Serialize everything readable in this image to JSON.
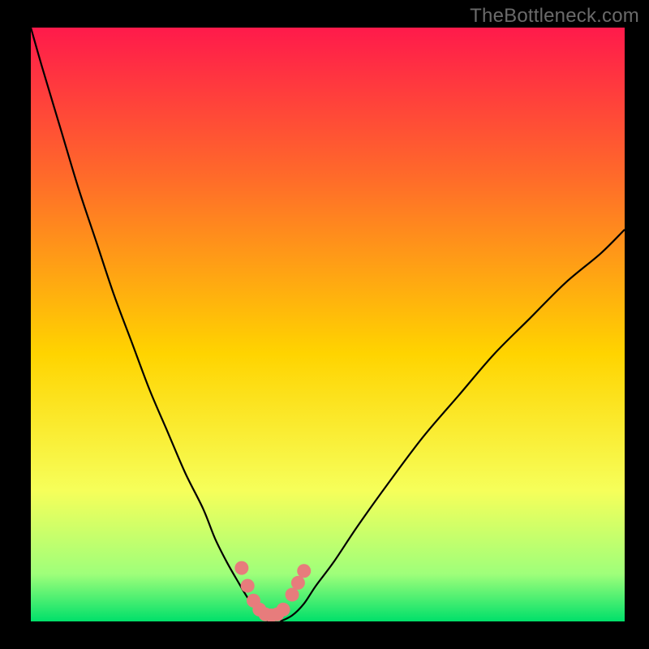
{
  "watermark": "TheBottleneck.com",
  "chart_data": {
    "type": "line",
    "title": "",
    "xlabel": "",
    "ylabel": "",
    "xlim": [
      0,
      100
    ],
    "ylim": [
      0,
      100
    ],
    "background_gradient": {
      "top": "#ff1a4b",
      "upper_mid": "#ff6a2a",
      "mid": "#ffd400",
      "lower_mid": "#f6ff5a",
      "bottom_band": "#9fff7a",
      "bottom": "#00e06a"
    },
    "series": [
      {
        "name": "curve-left",
        "x": [
          0,
          2,
          5,
          8,
          11,
          14,
          17,
          20,
          23,
          26,
          29,
          31,
          33,
          35,
          36.5,
          38,
          39,
          40
        ],
        "y": [
          100,
          93,
          83,
          73,
          64,
          55,
          47,
          39,
          32,
          25,
          19,
          14,
          10,
          6.5,
          4,
          2,
          1,
          0
        ]
      },
      {
        "name": "curve-right",
        "x": [
          42,
          44,
          46,
          48,
          51,
          55,
          60,
          66,
          72,
          78,
          84,
          90,
          96,
          100
        ],
        "y": [
          0,
          1,
          3,
          6,
          10,
          16,
          23,
          31,
          38,
          45,
          51,
          57,
          62,
          66
        ]
      }
    ],
    "bottom_green_band_y": 8,
    "points": [
      {
        "x": 35.5,
        "y": 9.0
      },
      {
        "x": 36.5,
        "y": 6.0
      },
      {
        "x": 37.5,
        "y": 3.5
      },
      {
        "x": 38.5,
        "y": 2.0
      },
      {
        "x": 39.5,
        "y": 1.2
      },
      {
        "x": 40.5,
        "y": 1.0
      },
      {
        "x": 41.5,
        "y": 1.2
      },
      {
        "x": 42.5,
        "y": 2.0
      },
      {
        "x": 44.0,
        "y": 4.5
      },
      {
        "x": 45.0,
        "y": 6.5
      },
      {
        "x": 46.0,
        "y": 8.5
      }
    ],
    "point_color": "#e77c7c",
    "curve_color": "#000000"
  }
}
